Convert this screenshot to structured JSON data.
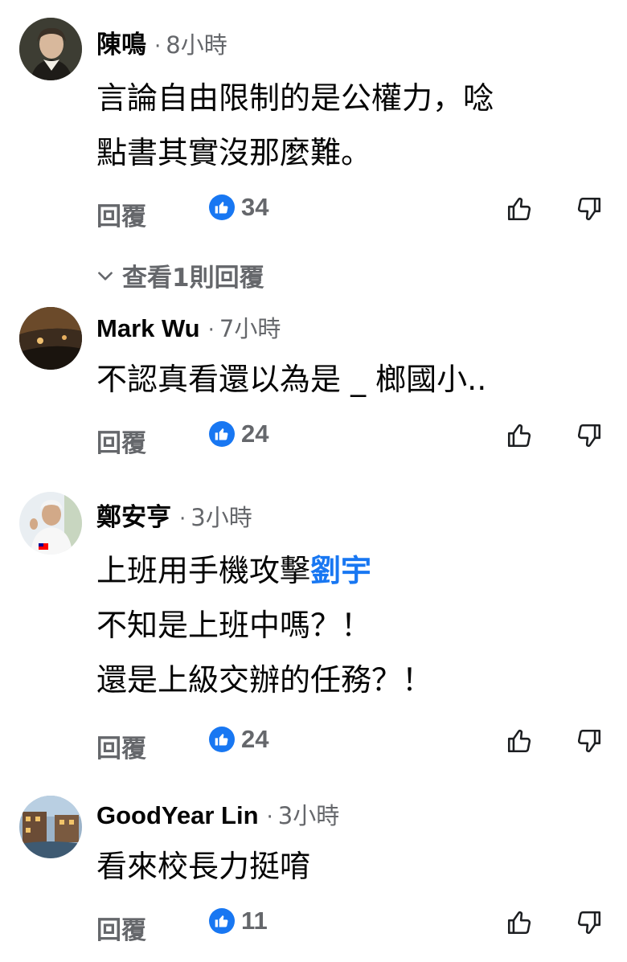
{
  "comments": [
    {
      "author": "陳鳴",
      "time": "8小時",
      "lines": [
        "言論自由限制的是公權力，唸",
        "點書其實沒那麼難。"
      ],
      "reply_label": "回覆",
      "likes": "34",
      "view_replies": "查看1則回覆"
    },
    {
      "author": "Mark Wu",
      "time": "7小時",
      "lines": [
        "不認真看還以為是 _ 榔國小.."
      ],
      "reply_label": "回覆",
      "likes": "24"
    },
    {
      "author": "鄭安亨",
      "time": "3小時",
      "line1_text": "上班用手機攻擊",
      "line1_mention": "劉宇",
      "lines_rest": [
        "不知是上班中嗎？！",
        "還是上級交辦的任務？！"
      ],
      "reply_label": "回覆",
      "likes": "24"
    },
    {
      "author": "GoodYear Lin",
      "time": "3小時",
      "lines": [
        "看來校長力挺唷"
      ],
      "reply_label": "回覆",
      "likes": "11"
    }
  ],
  "separator": "·",
  "icons": {
    "like_badge": "thumbs-up-filled-icon",
    "like_button": "thumbs-up-outline-icon",
    "dislike_button": "thumbs-down-outline-icon",
    "expand": "chevron-down-icon"
  },
  "colors": {
    "brand_blue": "#1877f2",
    "secondary_text": "#65676b",
    "primary_text": "#050505"
  }
}
